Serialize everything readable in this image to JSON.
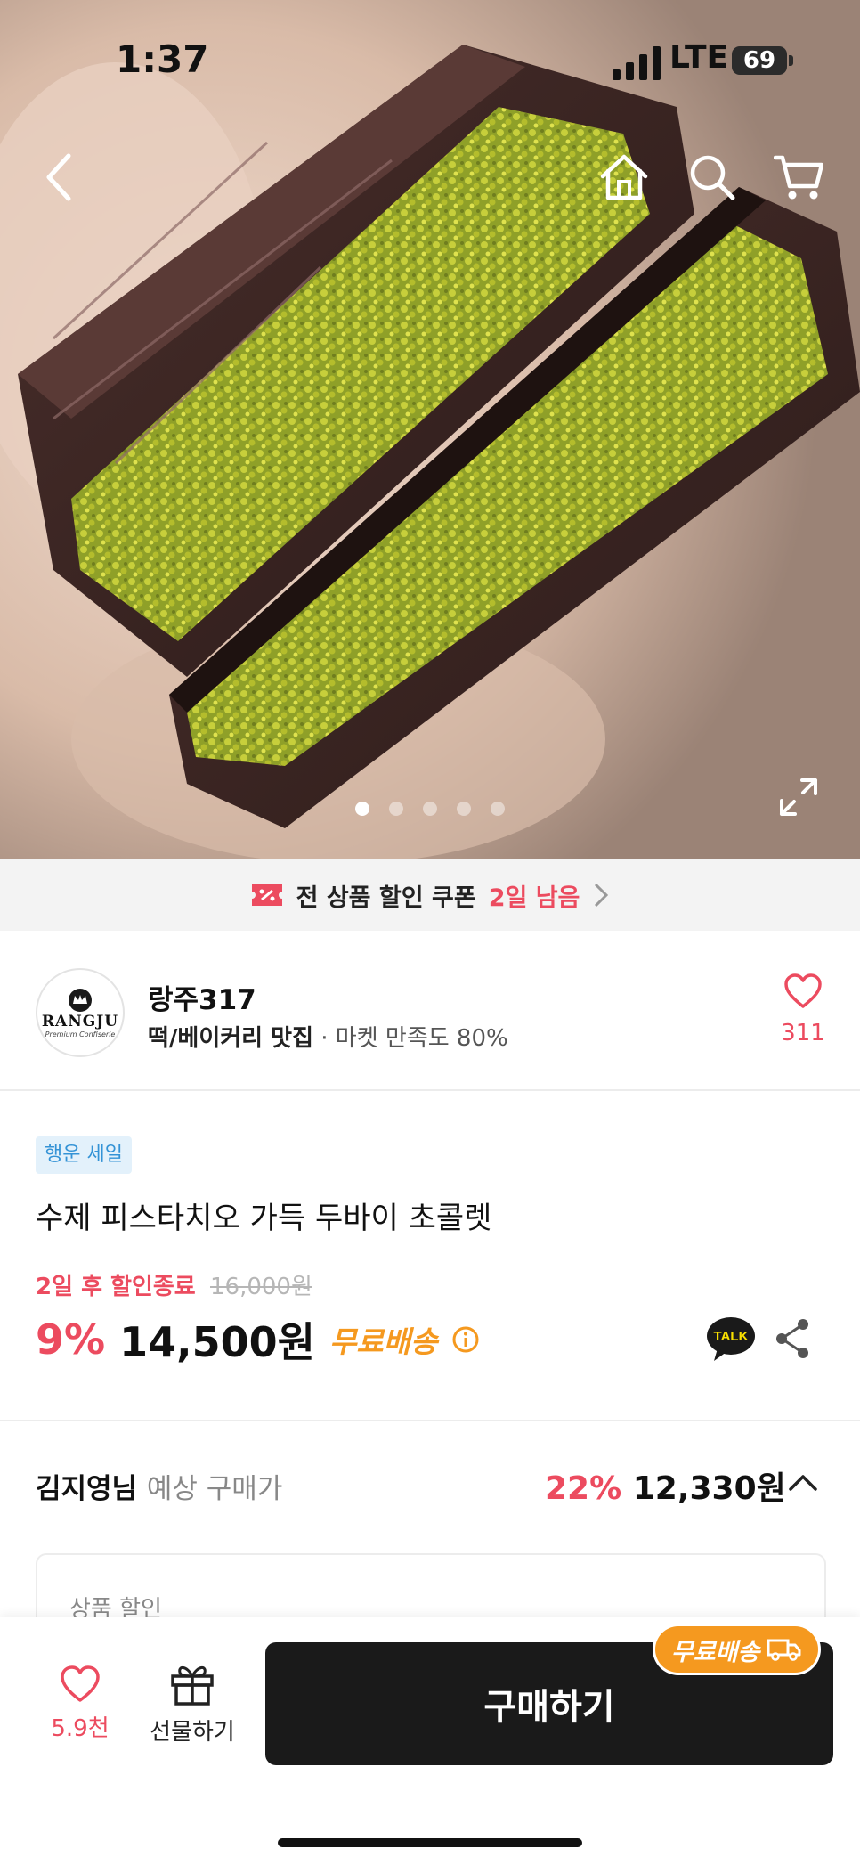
{
  "status": {
    "time": "1:37",
    "network": "LTE",
    "battery": "69"
  },
  "nav": {
    "back": "chevron-left-icon",
    "home": "home-icon",
    "search": "search-icon",
    "cart": "cart-icon",
    "expand": "expand-icon"
  },
  "carousel": {
    "count": 5,
    "active": 1
  },
  "coupon": {
    "text": "전 상품 할인 쿠폰",
    "remaining": "2일 남음"
  },
  "seller": {
    "logo_text": "RANGJU",
    "logo_sub": "Premium Confiserie",
    "name": "랑주317",
    "category": "떡/베이커리 맛집",
    "satisfaction": "· 마켓 만족도 80%",
    "fav_count": "311"
  },
  "product": {
    "badge": "행운 세일",
    "title": "수제 피스타치오 가득 두바이 초콜렛",
    "deadline": "2일 후 할인종료",
    "original_price": "16,000원",
    "discount": "9%",
    "price": "14,500원",
    "shipping": "무료배송"
  },
  "share": {
    "talk_label": "TALK"
  },
  "expected": {
    "name": "김지영님",
    "label": "예상 구매가",
    "discount": "22%",
    "price": "12,330원"
  },
  "discount_box": {
    "label": "상품 할인"
  },
  "bottom": {
    "likes": "5.9천",
    "gift": "선물하기",
    "buy": "구매하기",
    "free_shipping": "무료배송"
  },
  "colors": {
    "accent_red": "#ec4b5f",
    "shipping_orange": "#f5991f",
    "buy_black": "#1a1a1a"
  }
}
